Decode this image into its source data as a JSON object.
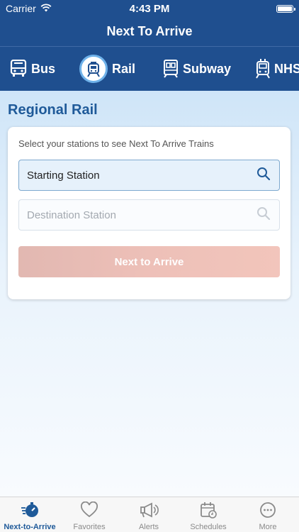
{
  "status": {
    "carrier": "Carrier",
    "time": "4:43 PM"
  },
  "header": {
    "title": "Next To Arrive"
  },
  "modes": [
    {
      "label": "Bus",
      "icon": "bus-icon",
      "selected": false
    },
    {
      "label": "Rail",
      "icon": "train-icon",
      "selected": true
    },
    {
      "label": "Subway",
      "icon": "subway-icon",
      "selected": false
    },
    {
      "label": "NHS",
      "icon": "trolley-icon",
      "selected": false
    }
  ],
  "main": {
    "section_title": "Regional Rail",
    "hint": "Select your stations to see Next To Arrive Trains",
    "start_placeholder": "Starting Station",
    "destination_placeholder": "Destination Station",
    "submit_label": "Next to Arrive"
  },
  "tabs": [
    {
      "label": "Next-to-Arrive",
      "icon": "stopwatch-icon",
      "active": true
    },
    {
      "label": "Favorites",
      "icon": "heart-icon",
      "active": false
    },
    {
      "label": "Alerts",
      "icon": "megaphone-icon",
      "active": false
    },
    {
      "label": "Schedules",
      "icon": "calendar-icon",
      "active": false
    },
    {
      "label": "More",
      "icon": "more-icon",
      "active": false
    }
  ],
  "colors": {
    "brand": "#1f4f8f",
    "accent": "#1f5a99",
    "button": "#edbdb5"
  }
}
